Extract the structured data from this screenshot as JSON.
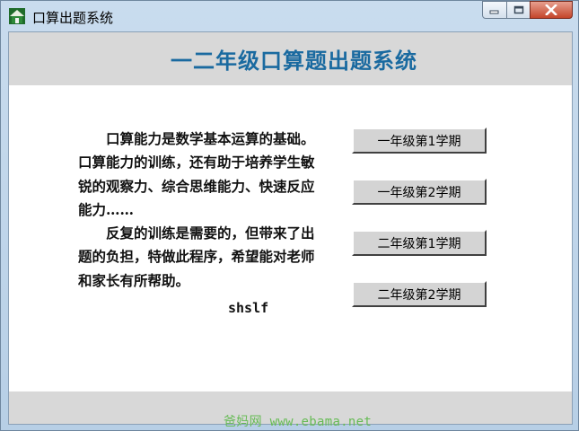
{
  "window": {
    "title": "口算出题系统",
    "controls": {
      "minimize": "minimize",
      "maximize": "maximize",
      "close": "close"
    }
  },
  "header": {
    "title": "一二年级口算题出题系统"
  },
  "intro": {
    "paragraphs": [
      "口算能力是数学基本运算的基础。口算能力的训练，还有助于培养学生敏锐的观察力、综合思维能力、快速反应能力……",
      "反复的训练是需要的，但带来了出题的负担，特做此程序，希望能对老师和家长有所帮助。"
    ],
    "signature": "shslf"
  },
  "buttons": [
    {
      "label": "一年级第1学期"
    },
    {
      "label": "一年级第2学期"
    },
    {
      "label": "二年级第1学期"
    },
    {
      "label": "二年级第2学期"
    }
  ],
  "watermark": "爸妈网 www.ebama.net",
  "colors": {
    "header_title": "#1a6aa0",
    "band": "#d8d8d8",
    "watermark": "#66bb55"
  }
}
